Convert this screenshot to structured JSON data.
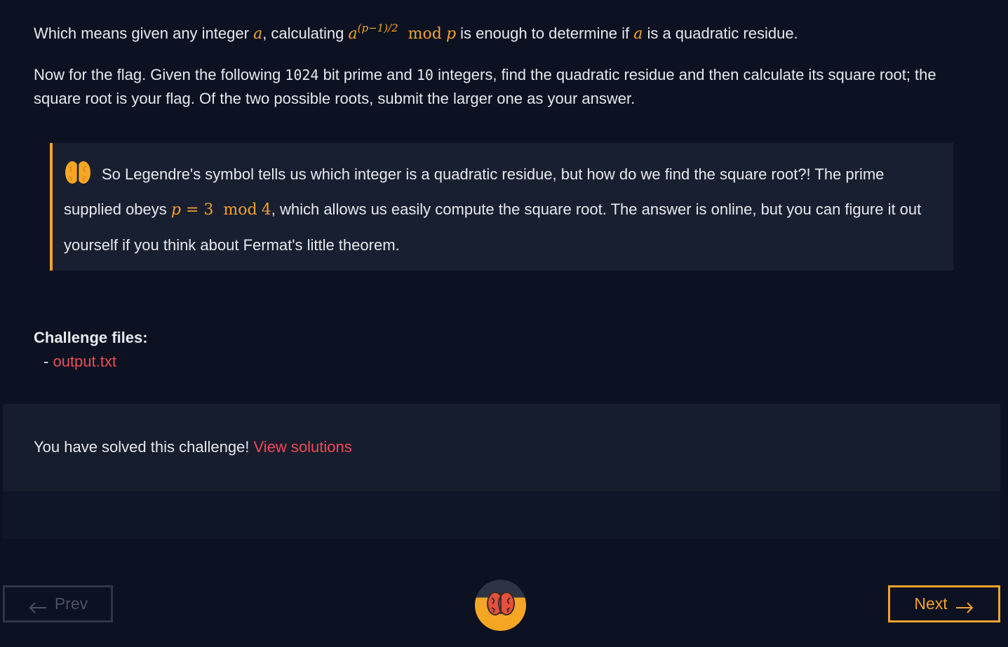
{
  "intro": {
    "text1": "Which means given any integer ",
    "var_a": "a",
    "text2": ", calculating ",
    "base": "a",
    "exponent": "(p−1)/2",
    "mod": "mod",
    "var_p": "p",
    "text3": " is enough to determine if ",
    "text4": " is a quadratic residue."
  },
  "flag_paragraph": {
    "text1": "Now for the flag. Given the following ",
    "bits": "1024",
    "text2": " bit prime and ",
    "count": "10",
    "text3": " integers, find the quadratic residue and then calculate its square root; the square root is your flag. Of the two possible roots, submit the larger one as your answer."
  },
  "callout": {
    "text1": "So Legendre's symbol tells us which integer is a quadratic residue, but how do we find the square root?! The prime supplied obeys ",
    "math_p": "p",
    "math_eq": " = 3",
    "math_mod": "mod",
    "math_4": "4",
    "text2": ", which allows us easily compute the square root. The answer is online, but you can figure it out yourself if you think about Fermat's little theorem.",
    "icon": "brain-icon",
    "accent_color": "#f2a22f"
  },
  "files": {
    "title": "Challenge files:",
    "dash": "- ",
    "items": [
      "output.txt"
    ]
  },
  "solved": {
    "text": "You have solved this challenge! ",
    "link": "View solutions"
  },
  "nav": {
    "prev_label": "Prev",
    "next_label": "Next",
    "prev_icon": "arrow-left-icon",
    "next_icon": "arrow-right-icon",
    "logo_icon": "brain-logo-icon"
  },
  "colors": {
    "background": "#0c1221",
    "accent": "#f2a22f",
    "link": "#ef4b57"
  }
}
